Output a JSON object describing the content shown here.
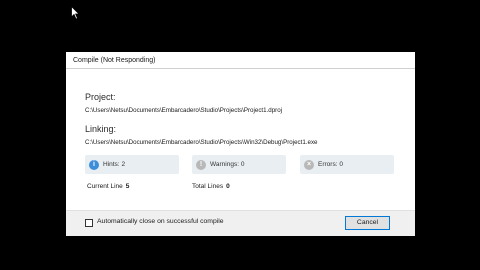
{
  "dialog": {
    "title": "Compile (Not Responding)",
    "project_heading": "Project:",
    "project_path": "C:\\Users\\Netsu\\Documents\\Embarcadero\\Studio\\Projects\\Project1.dproj",
    "linking_heading": "Linking:",
    "linking_path": "C:\\Users\\Netsu\\Documents\\Embarcadero\\Studio\\Projects\\Win32\\Debug\\Project1.exe",
    "hints": {
      "label": "Hints:",
      "value": "2",
      "icon": "info-icon",
      "color": "#3c8ed8"
    },
    "warnings": {
      "label": "Warnings:",
      "value": "0",
      "icon": "warning-icon",
      "color": "#b8b8b8"
    },
    "errors": {
      "label": "Errors:",
      "value": "0",
      "icon": "error-icon",
      "color": "#b8b8b8"
    },
    "current_line": {
      "label": "Current Line",
      "value": "5"
    },
    "total_lines": {
      "label": "Total Lines",
      "value": "0"
    },
    "auto_close_label": "Automatically close on successful compile",
    "auto_close_checked": false,
    "cancel_label": "Cancel"
  }
}
